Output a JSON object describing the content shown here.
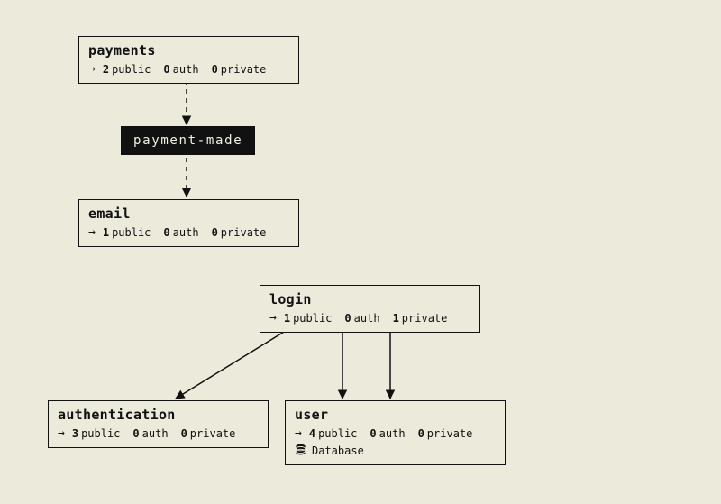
{
  "nodes": {
    "payments": {
      "title": "payments",
      "public_count": "2",
      "public_label": "public",
      "auth_count": "0",
      "auth_label": "auth",
      "private_count": "0",
      "private_label": "private"
    },
    "email": {
      "title": "email",
      "public_count": "1",
      "public_label": "public",
      "auth_count": "0",
      "auth_label": "auth",
      "private_count": "0",
      "private_label": "private"
    },
    "login": {
      "title": "login",
      "public_count": "1",
      "public_label": "public",
      "auth_count": "0",
      "auth_label": "auth",
      "private_count": "1",
      "private_label": "private"
    },
    "authentication": {
      "title": "authentication",
      "public_count": "3",
      "public_label": "public",
      "auth_count": "0",
      "auth_label": "auth",
      "private_count": "0",
      "private_label": "private"
    },
    "user": {
      "title": "user",
      "public_count": "4",
      "public_label": "public",
      "auth_count": "0",
      "auth_label": "auth",
      "private_count": "0",
      "private_label": "private",
      "extra_label": "Database"
    }
  },
  "event": {
    "label": "payment-made"
  }
}
